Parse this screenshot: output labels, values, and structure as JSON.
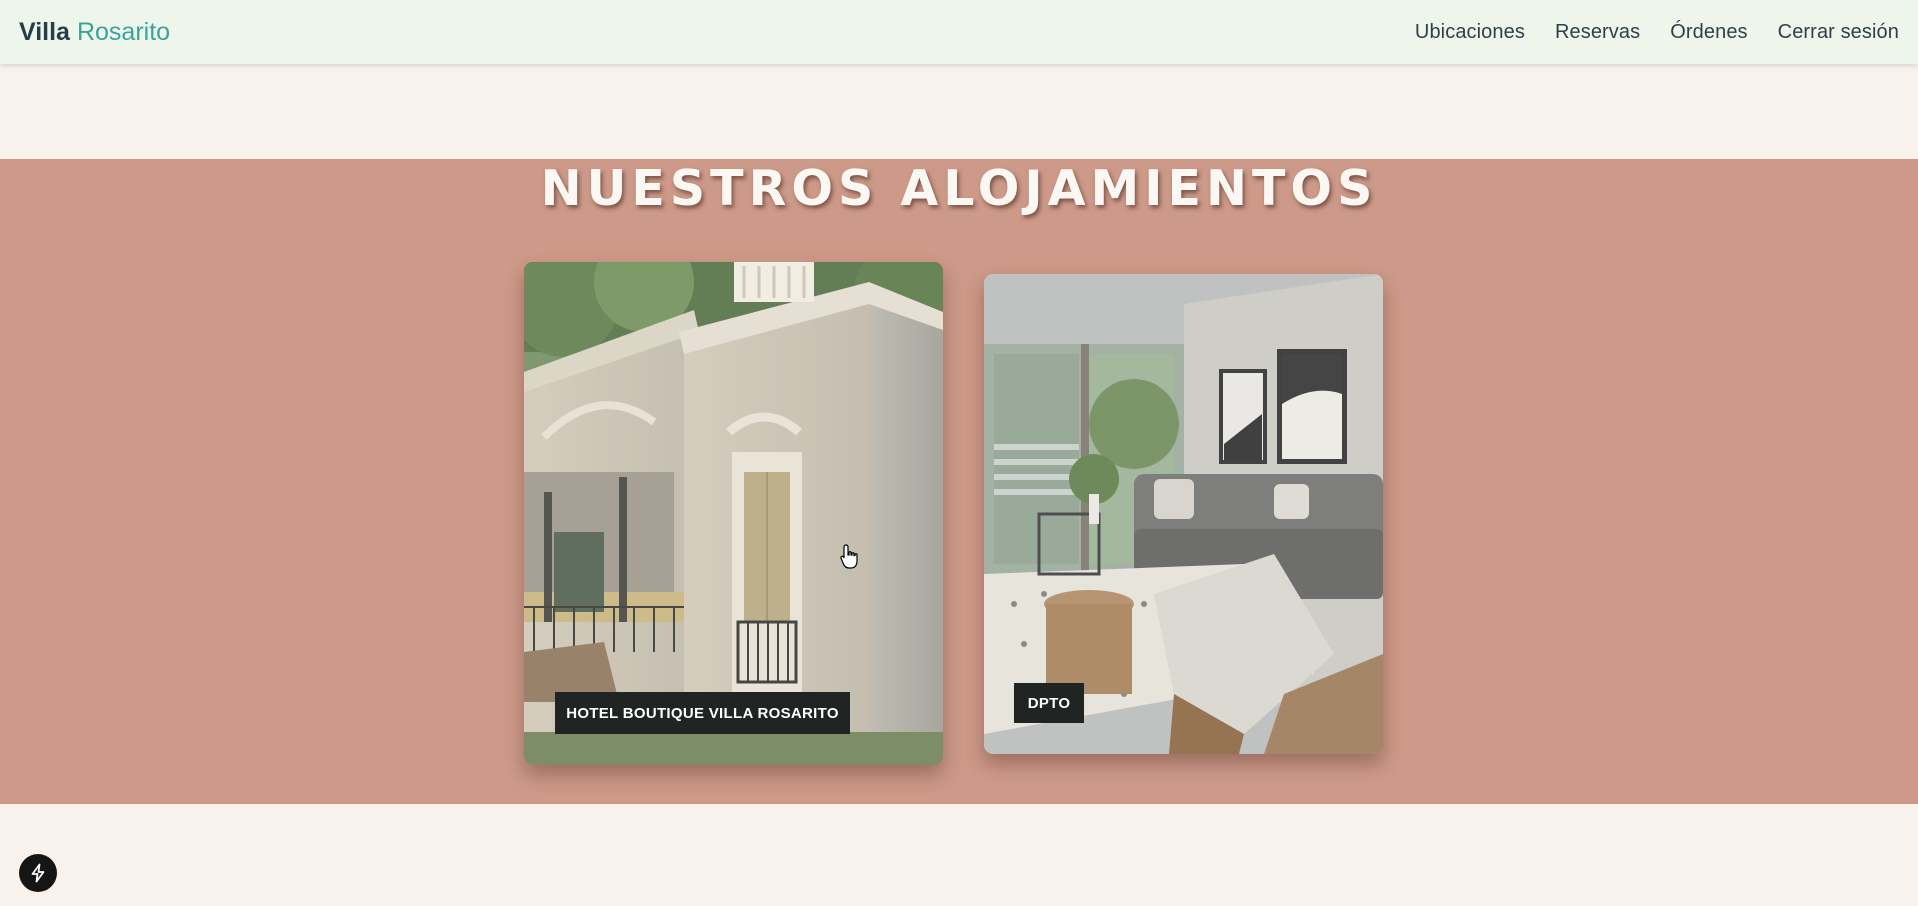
{
  "header": {
    "brand_part1": "Villa",
    "brand_part2": "Rosarito",
    "nav": {
      "locations": "Ubicaciones",
      "reservations": "Reservas",
      "orders": "Órdenes",
      "logout": "Cerrar sesión"
    }
  },
  "section": {
    "title": "NUESTROS ALOJAMIENTOS"
  },
  "cards": {
    "hotel": {
      "label": "HOTEL BOUTIQUE VILLA ROSARITO",
      "image_icon": "building-facade-photo"
    },
    "dpto": {
      "label": "DPTO",
      "image_icon": "living-room-photo"
    }
  },
  "fab": {
    "icon": "lightning-icon"
  },
  "colors": {
    "nav_bg": "#eef6ec",
    "brand_accent": "#3aa39a",
    "band_bg": "#cd9988",
    "page_bg": "#f9f1ec",
    "label_bg": "#202423"
  }
}
